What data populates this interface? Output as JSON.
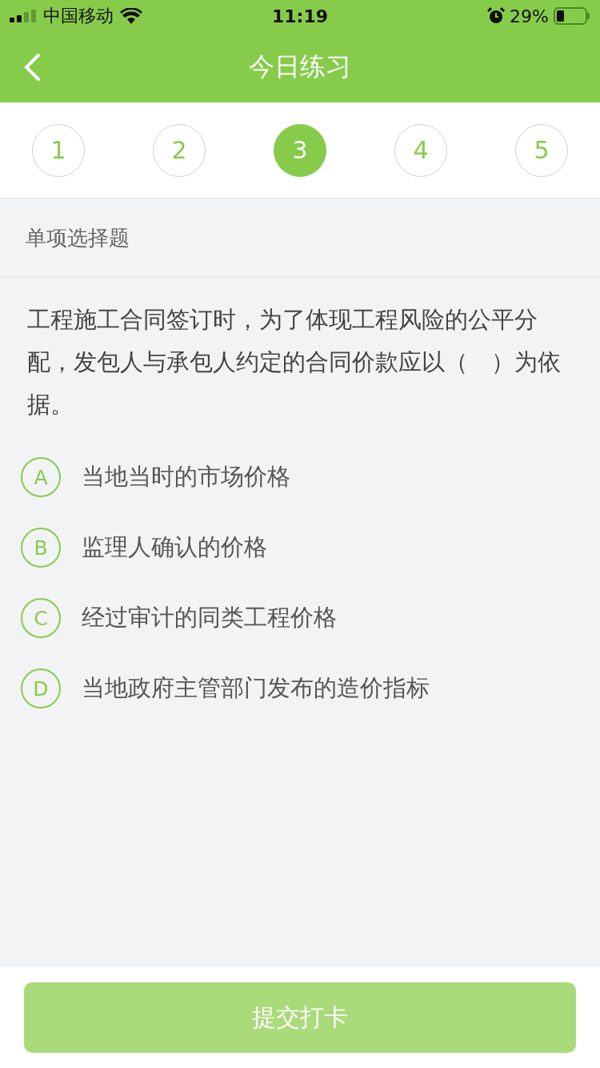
{
  "status_bar": {
    "carrier": "中国移动",
    "time": "11:19",
    "battery": "29%"
  },
  "nav_bar": {
    "title": "今日练习"
  },
  "steps": [
    {
      "label": "1",
      "selected": false
    },
    {
      "label": "2",
      "selected": false
    },
    {
      "label": "3",
      "selected": true
    },
    {
      "label": "4",
      "selected": false
    },
    {
      "label": "5",
      "selected": false
    }
  ],
  "question": {
    "type_label": "单项选择题",
    "text": "工程施工合同签订时，为了体现工程风险的公平分配，发包人与承包人约定的合同价款应以（　）为依据。",
    "options": [
      {
        "letter": "A",
        "text": "当地当时的市场价格",
        "selected": false
      },
      {
        "letter": "B",
        "text": "监理人确认的价格",
        "selected": false
      },
      {
        "letter": "C",
        "text": "经过审计的同类工程价格",
        "selected": false
      },
      {
        "letter": "D",
        "text": "当地政府主管部门发布的造价指标",
        "selected": false
      }
    ]
  },
  "submit_button": {
    "label": "提交打卡",
    "disabled": true
  }
}
